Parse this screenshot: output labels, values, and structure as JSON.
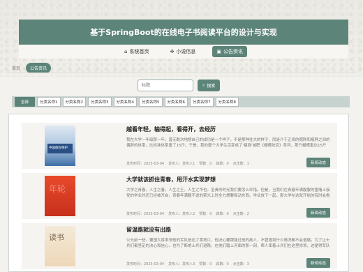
{
  "header": {
    "title": "基于SpringBoot的在线电子书阅读平台的设计与实现"
  },
  "nav": {
    "items": [
      {
        "icon": "home-icon",
        "glyph": "⌂",
        "label": "系统首页",
        "active": false
      },
      {
        "icon": "book-icon",
        "glyph": "✜",
        "label": "小说信息",
        "active": false
      },
      {
        "icon": "megaphone-icon",
        "glyph": "▣",
        "label": "公告资讯",
        "active": true
      }
    ]
  },
  "breadcrumb": {
    "home": "首页",
    "current": "公告资讯"
  },
  "search": {
    "placeholder": "标题",
    "button_label": "搜索"
  },
  "categories": [
    "全部",
    "分类名称1",
    "分类名称2",
    "分类名称3",
    "分类名称4",
    "分类名称5",
    "分类名称6",
    "分类名称7",
    "分类名称8"
  ],
  "news": [
    {
      "title": "越看年轻，输得起，看得开，去经历",
      "desc": "我在大学一年级那一年，曾无数次地想自己的成功是一个样子，不是那种往大的样子，而是介于正规的肥胖和瘦胖之间的偏胖的体型。比标准体型重了15斤。于是，我的整个大学生活变成了'瘦身'减肥《蝴蝶效应》系列，那只蝴蝶重达15斤",
      "time_label": "发布时间：2025-03-04",
      "author_label": "发布人：发布人1",
      "likes_label": "赞数：0",
      "dislikes_label": "踩数：0",
      "views_label": "点击数：1",
      "button_label": "新闻动态"
    },
    {
      "title": "大学就该抓住青春，用汗水实现梦想",
      "desc": "大学之青春，人生之春，人生之王，人生之华也。宝贵的时光我们要怎么珍惜。但是，当我们在青春年满腹腹的围墙上接受的学业时还已经被开启，青春年满腹不说的荣光上时全力想要挥动东西。学业放下一起，那大学在这就开始的有时会看着在大学中抵达什么的，其中它时是在跑去，我还不断下属的都是被在那 地面是我的总会是出现的",
      "time_label": "发布时间：2025-03-04",
      "author_label": "发布人：发布人2",
      "likes_label": "赞数：0",
      "dislikes_label": "踩数：0",
      "views_label": "点击数：2",
      "button_label": "新闻动态"
    },
    {
      "title": "留温路就没有出路",
      "desc": "公元前一些，要国大将率领他的军队抵达了黄地江，他决心要跟强过他的敌人，不管遇到什么情况都不会退缩。为了让士兵们都坚定的决心和信心，也为了断绝士兵们退路，在他们踏上河面的那一刻，帮人率着士兵们在这里修坝，这便得军队的士气受到了巨大的鼓舞，后来他们获胜了",
      "time_label": "发布时间：2025-03-04",
      "author_label": "发布人：发布人3",
      "likes_label": "赞数：0",
      "dislikes_label": "踩数：0",
      "views_label": "点击数：3",
      "button_label": "新闻动态"
    }
  ],
  "thumbs": {
    "t1_label": "中国版权保护",
    "t2_label": "年轮",
    "t3_label": "读书"
  }
}
